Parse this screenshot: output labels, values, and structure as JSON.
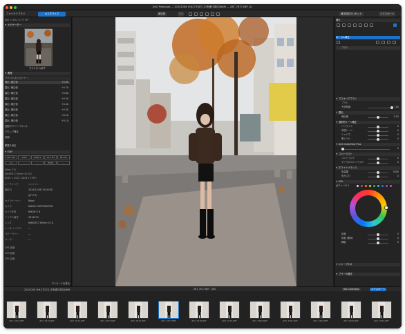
{
  "window": {
    "title": "DxO PhotoLab — 20241208 かみさきまち_中央通り周辺/JNKM — Z6T_7677.NEF (1)"
  },
  "toolbar": {
    "tab_library": "フォトライブラリ",
    "tab_customize": "カスタマイズ",
    "compare_label": "補正前",
    "zoom_label": "1:1",
    "history_btn": "補正設定のリセット",
    "export_btn": "エクスポート"
  },
  "left": {
    "info_line": "600 × 400 / 2.72 MP",
    "navigator_title": "ナビゲーター",
    "nav_caption": "アジャスト/ボア",
    "histogram_label": "履歴",
    "presets_title": "アドバンスヒストリー",
    "history_items": [
      {
        "label": "露出: 補正値",
        "value": "+0.80"
      },
      {
        "label": "露出: 補正値",
        "value": "+0.70"
      },
      {
        "label": "露出: 補正値",
        "value": "+0.60"
      },
      {
        "label": "露出: 補正値",
        "value": "+0.50"
      },
      {
        "label": "露出: 補正値",
        "value": "+0.40"
      },
      {
        "label": "露出: 補正値",
        "value": "+0.30"
      },
      {
        "label": "露出: 補正値",
        "value": "+0.20"
      },
      {
        "label": "露出: 補正値",
        "value": "+0.10"
      },
      {
        "label": "自動ホワイトバランス",
        "value": ""
      },
      {
        "label": "クロップ補正",
        "value": ""
      },
      {
        "label": "初期",
        "value": ""
      }
    ],
    "history_footer": "履歴を消去",
    "exif_title": "EXIF",
    "exif_values": [
      "ISO 100",
      "1/4.0",
      "1/500 s",
      "+0.3 EV",
      "85 mm"
    ],
    "exif_modes": [
      "1:1",
      "—",
      "—",
      "3000",
      "—"
    ],
    "lens_line": "Nikon Z 6",
    "lens_line2": "NIKKOR Z 85mm f/1.8 S",
    "size_line": "6048 × 4024 (4048 x 5 MP)",
    "meta": [
      {
        "k": "レーティング",
        "v": "☆☆☆☆☆"
      },
      {
        "k": "撮影日",
        "v": "2024/12/08 13:00:00"
      },
      {
        "k": "",
        "v": "(JST+9)"
      },
      {
        "k": "カメラメーカー",
        "v": "Nikon"
      },
      {
        "k": "カメラ",
        "v": "NIKON CORPORATION"
      },
      {
        "k": "カメラ本体",
        "v": "NIKON Z 6"
      },
      {
        "k": "シリアル番号",
        "v": "3014570"
      },
      {
        "k": "レンズ",
        "v": "NIKKOR Z 85mm f/1.8"
      },
      {
        "k": "レンズ シリアル",
        "v": "—"
      },
      {
        "k": "コピーライト",
        "v": "—"
      },
      {
        "k": "オーサー",
        "v": "—"
      }
    ],
    "gps": [
      {
        "k": "GPS 緯度",
        "v": ""
      },
      {
        "k": "GPS 経度",
        "v": ""
      },
      {
        "k": "GPS 高度",
        "v": ""
      }
    ],
    "footer": "マイモードを表示"
  },
  "center": {
    "status": "Z6T_7677.NEF",
    "filmbar_path": "20241208 かみさきまち_中央通り周辺/JNKM",
    "filmbar_count": "1/80",
    "filmbar_right": "Nik Collection",
    "filmbar_export": "エクスポート"
  },
  "right": {
    "panel_title": "補正",
    "section_local": "ローカル補正",
    "brush_label": "ブラシ",
    "tone_title": "マスキングブラシ",
    "tone_sub": "ブラシ",
    "tone_value_label": "不透明度",
    "tone_value": "100",
    "exposure_title": "露出",
    "exposure_row": "補正値",
    "exposure_value": "0.00",
    "selective_title": "選択的トーン補正",
    "selective_rows": [
      {
        "label": "ハイライト",
        "value": "0"
      },
      {
        "label": "中間トーン",
        "value": "0"
      },
      {
        "label": "シャドウ",
        "value": "0"
      },
      {
        "label": "黒レベル",
        "value": "0"
      }
    ],
    "smart_title": "DxO ClearView Plus",
    "smart_value": "0",
    "contrast_title": "コントラスト",
    "contrast_rows": [
      {
        "label": "コントラスト",
        "value": "0"
      },
      {
        "label": "マイクロコントラスト",
        "value": "0"
      }
    ],
    "color_title": "ホワイトバランス",
    "color_rows": [
      {
        "label": "色温度",
        "value": "5000"
      },
      {
        "label": "色かぶり",
        "value": "0"
      }
    ],
    "hsl_title": "HSL",
    "hsl_channel": "全チャンネル",
    "hsl_rows": [
      {
        "label": "色相",
        "value": "0"
      },
      {
        "label": "彩度 (飽和)",
        "value": "0"
      },
      {
        "label": "輝度",
        "value": "0"
      }
    ],
    "hsl_wheel_value": "0",
    "sharpen_title": "シャープネス",
    "blur_title": "ブラーの補正"
  },
  "film": {
    "items": [
      {
        "name": "Z6T_7672.NEF"
      },
      {
        "name": "Z6T_7673.NEF"
      },
      {
        "name": "Z6T_7674.NEF"
      },
      {
        "name": "Z6T_7675.NEF"
      },
      {
        "name": "Z6T_7676.NEF"
      },
      {
        "name": "Z6T_7677.NEF"
      },
      {
        "name": "Z6T_7678.NEF"
      },
      {
        "name": "Z6T_7679.NEF"
      },
      {
        "name": "Z6T_7680.NEF"
      },
      {
        "name": "Z6T_7681.NEF"
      },
      {
        "name": "Z6T_7682.NEF"
      },
      {
        "name": "Z6T_7683.NEF"
      },
      {
        "name": "Z6T_7684.NEF"
      }
    ]
  },
  "colors": {
    "accent": "#1e73c8",
    "panel": "#242424",
    "header": "#303030"
  }
}
